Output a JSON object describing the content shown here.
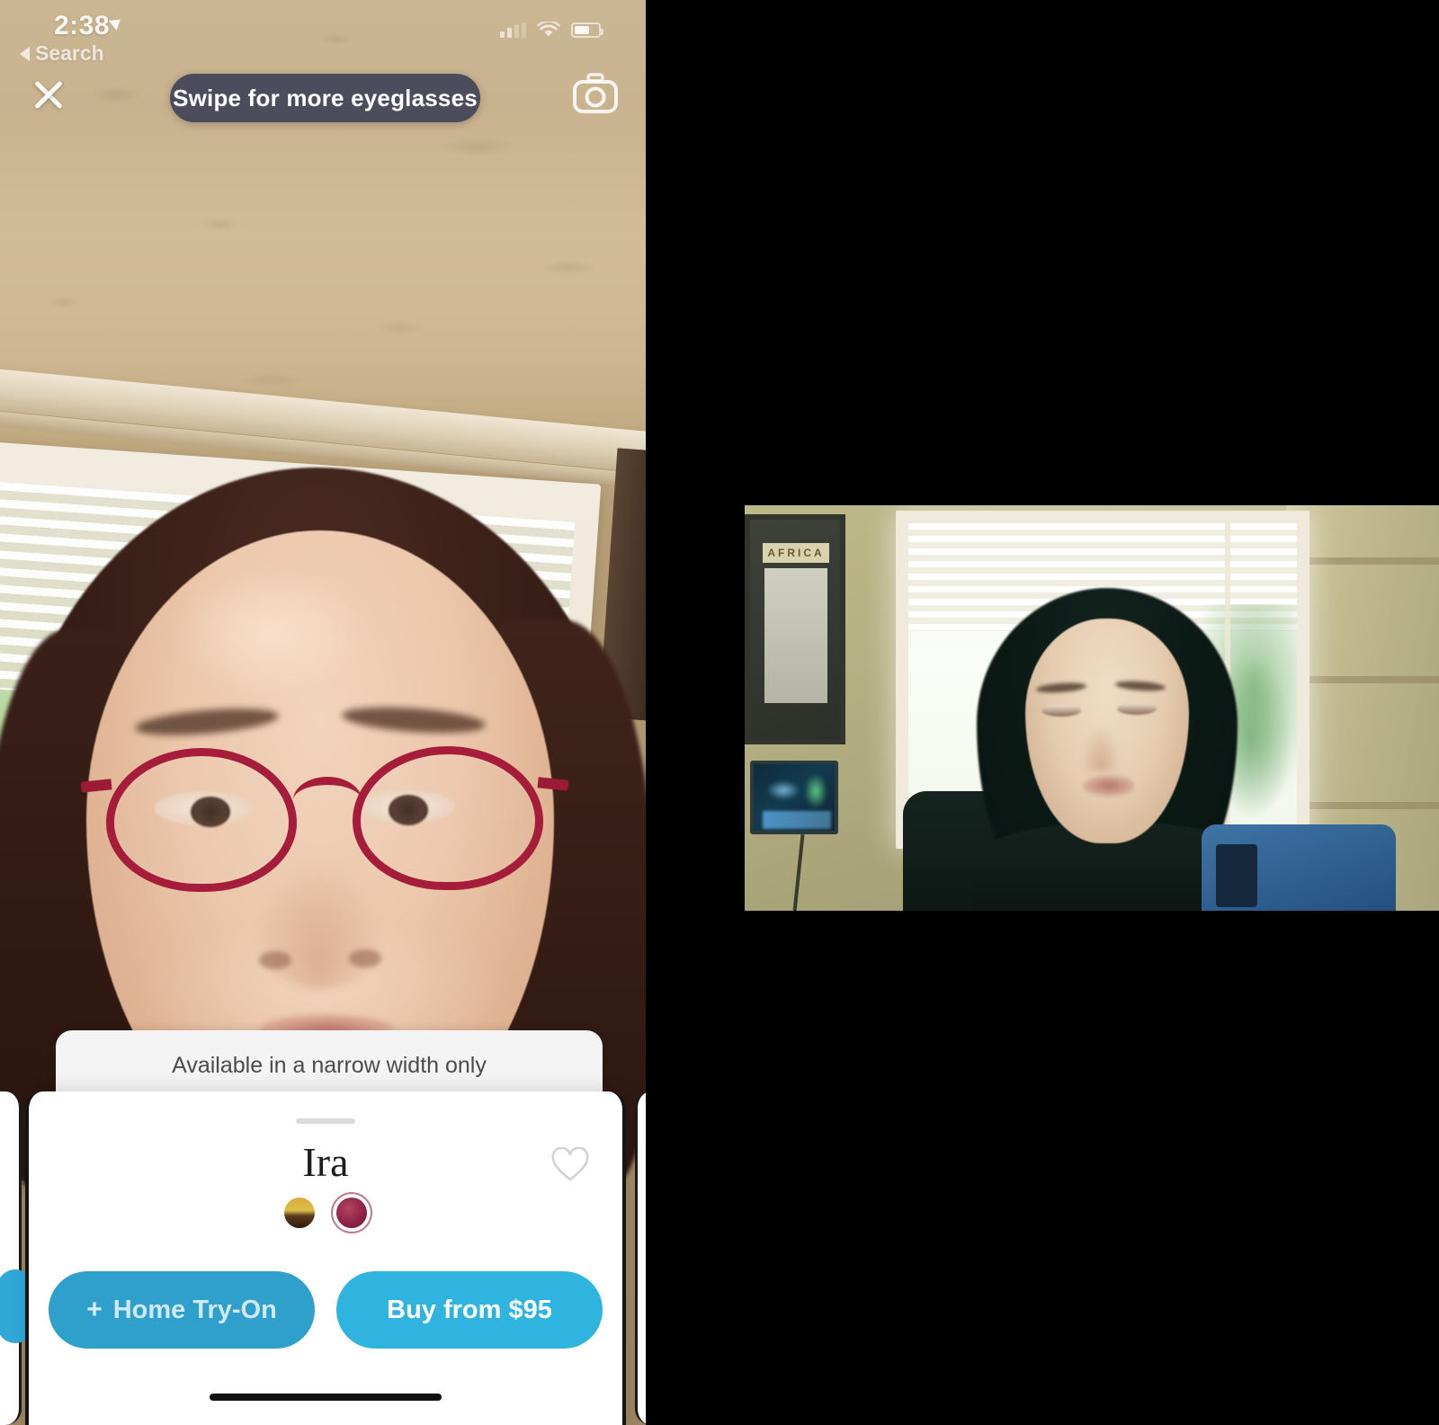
{
  "phone": {
    "status_bar": {
      "time": "2:38",
      "location_icon": "location-arrow-icon",
      "signal_icon": "cellular-bars-icon",
      "wifi_icon": "wifi-icon",
      "battery_icon": "battery-icon"
    },
    "back_link": {
      "label": "Search",
      "icon": "back-triangle-icon"
    },
    "top_controls": {
      "close_icon": "close-x-icon",
      "swipe_hint": "Swipe for more eyeglasses",
      "camera_icon": "camera-icon"
    },
    "banner": {
      "text": "Available in a narrow width only"
    },
    "product_card": {
      "title": "Ira",
      "favorite_icon": "heart-outline-icon",
      "drag_handle": "drag-handle",
      "swatches": [
        {
          "name": "gold-tortoise-swatch",
          "color": "#d9a93c",
          "selected": false
        },
        {
          "name": "burgundy-swatch",
          "color": "#8e2347",
          "selected": true
        }
      ],
      "buttons": {
        "home_try_on": "Home Try-On",
        "home_try_on_plus": "+",
        "buy": "Buy from $95"
      }
    },
    "colors": {
      "primary_blue": "#2fb4e0",
      "secondary_blue": "#2f9fcc",
      "pill_dark": "#4b4c5c",
      "glasses_red": "#a51d3a"
    }
  },
  "video_panel": {
    "label": "video-call-participant",
    "background": "#000000"
  }
}
